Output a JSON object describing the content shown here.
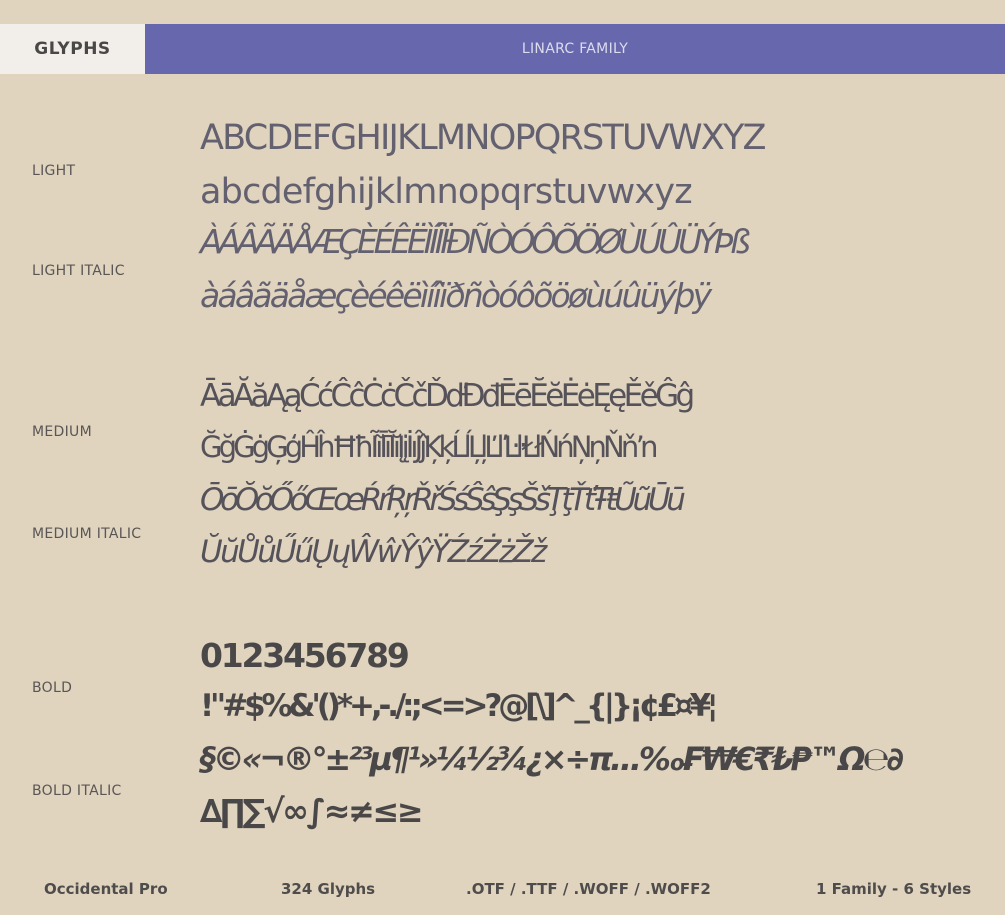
{
  "header": {
    "tab_glyphs": "GLYPHS",
    "tab_family": "LINARC FAMILY"
  },
  "labels": {
    "light": "LIGHT",
    "light_italic": "LIGHT ITALIC",
    "medium": "MEDIUM",
    "medium_italic": "MEDIUM ITALIC",
    "bold": "BOLD",
    "bold_italic": "BOLD ITALIC"
  },
  "glyph_rows": {
    "light_1": "ABCDEFGHIJKLMNOPQRSTUVWXYZ",
    "light_2": "abcdefghijklmnopqrstuvwxyz",
    "light_italic_1": "ÀÁÂÃÄÅÆÇÈÉÊËÌÍÎÏÐÑÒÓÔÕÖØÙÚÛÜÝÞß",
    "light_italic_2": "àáâãäåæçèéêëìíîïðñòóôõöøùúûüýþÿ",
    "medium_1": "ĀāĂăĄąĆćĈĉĊċČčĎďĐđĒēĔĕĖėĘęĚěĜĝ",
    "medium_2": "ĞğĠġĢģĤĥĦħĨĩĪīĬĭĮįİıĴĵĶķĹĺĻļĽľĿŀŁłŃńŅņŇňŉ",
    "medium_italic_1": "ŌōŎŏŐőŒœŔŕŖŗŘřŚśŜŝŞşŠšŢţŤťŦŧŨũŪū",
    "medium_italic_2": "ŬŭŮůŰűŲųŴŵŶŷŸŹźŻżŽž",
    "bold_1": "0123456789",
    "bold_2": "!\"#$%&'()*+,-./:;<=>?@[\\]^_{|}¡¢£¤¥¦",
    "bold_italic_1": "§©«¬®°±²³µ¶¹»¼½¾¿×÷π…‰₣₩€₹₺₱™Ω℮∂",
    "bold_italic_2": "∆∏∑√∞∫≈≠≤≥"
  },
  "footer": {
    "font_name": "Occidental Pro",
    "glyph_count": "324 Glyphs",
    "formats": ".OTF / .TTF / .WOFF / .WOFF2",
    "styles": "1 Family - 6 Styles"
  },
  "colors": {
    "background": "#e0d4bf",
    "header_accent": "#6667ad",
    "tab_active": "#f2efea",
    "text": "#4f4c4c"
  }
}
